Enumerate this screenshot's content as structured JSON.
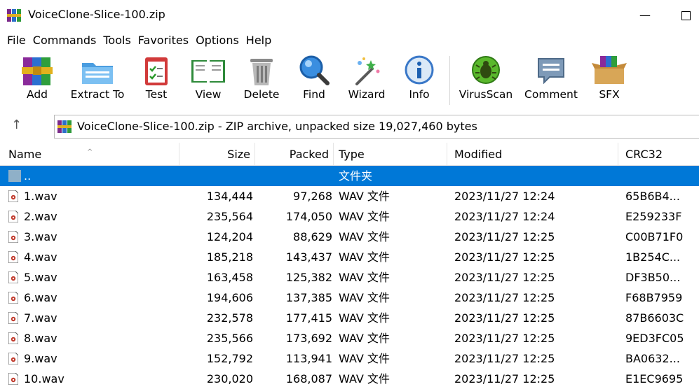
{
  "window": {
    "title": "VoiceClone-Slice-100.zip",
    "minimize": "—"
  },
  "menu": [
    "File",
    "Commands",
    "Tools",
    "Favorites",
    "Options",
    "Help"
  ],
  "toolbar": {
    "add": "Add",
    "extract": "Extract To",
    "test": "Test",
    "view": "View",
    "delete": "Delete",
    "find": "Find",
    "wizard": "Wizard",
    "info": "Info",
    "virusscan": "VirusScan",
    "comment": "Comment",
    "sfx": "SFX"
  },
  "address": {
    "up": "↑",
    "text": "VoiceClone-Slice-100.zip - ZIP archive, unpacked size 19,027,460 bytes"
  },
  "columns": {
    "name": "Name",
    "size": "Size",
    "packed": "Packed",
    "type": "Type",
    "modified": "Modified",
    "crc": "CRC32"
  },
  "parent_row": {
    "name": "..",
    "type": "文件夹"
  },
  "files": [
    {
      "name": "1.wav",
      "size": "134,444",
      "packed": "97,268",
      "type": "WAV 文件",
      "modified": "2023/11/27 12:24",
      "crc": "65B6B4..."
    },
    {
      "name": "2.wav",
      "size": "235,564",
      "packed": "174,050",
      "type": "WAV 文件",
      "modified": "2023/11/27 12:24",
      "crc": "E259233F"
    },
    {
      "name": "3.wav",
      "size": "124,204",
      "packed": "88,629",
      "type": "WAV 文件",
      "modified": "2023/11/27 12:25",
      "crc": "C00B71F0"
    },
    {
      "name": "4.wav",
      "size": "185,218",
      "packed": "143,437",
      "type": "WAV 文件",
      "modified": "2023/11/27 12:25",
      "crc": "1B254C..."
    },
    {
      "name": "5.wav",
      "size": "163,458",
      "packed": "125,382",
      "type": "WAV 文件",
      "modified": "2023/11/27 12:25",
      "crc": "DF3B50..."
    },
    {
      "name": "6.wav",
      "size": "194,606",
      "packed": "137,385",
      "type": "WAV 文件",
      "modified": "2023/11/27 12:25",
      "crc": "F68B7959"
    },
    {
      "name": "7.wav",
      "size": "232,578",
      "packed": "177,415",
      "type": "WAV 文件",
      "modified": "2023/11/27 12:25",
      "crc": "87B6603C"
    },
    {
      "name": "8.wav",
      "size": "235,566",
      "packed": "173,692",
      "type": "WAV 文件",
      "modified": "2023/11/27 12:25",
      "crc": "9ED3FC05"
    },
    {
      "name": "9.wav",
      "size": "152,792",
      "packed": "113,941",
      "type": "WAV 文件",
      "modified": "2023/11/27 12:25",
      "crc": "BA0632..."
    },
    {
      "name": "10.wav",
      "size": "230,020",
      "packed": "168,087",
      "type": "WAV 文件",
      "modified": "2023/11/27 12:25",
      "crc": "E1EC9695"
    }
  ],
  "colors": {
    "selection": "#0078d7"
  }
}
